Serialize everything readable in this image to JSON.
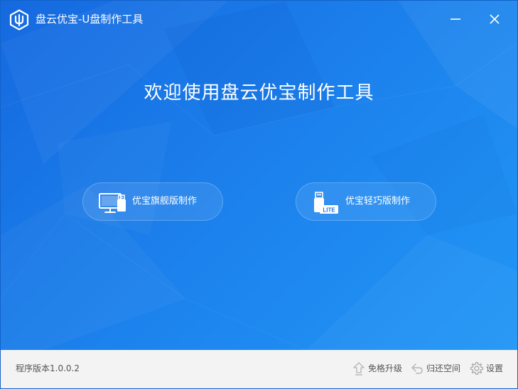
{
  "window": {
    "title": "盘云优宝-U盘制作工具",
    "minimize_icon": "minimize-icon",
    "close_icon": "close-icon"
  },
  "main": {
    "welcome_text": "欢迎使用盘云优宝制作工具",
    "buttons": [
      {
        "label": "优宝旗舰版制作",
        "icon": "computer-usb-icon"
      },
      {
        "label": "优宝轻巧版制作",
        "icon": "usb-lite-icon",
        "icon_badge": "LITE"
      }
    ]
  },
  "footer": {
    "version": "程序版本1.0.0.2",
    "links": [
      {
        "label": "免格升级",
        "icon": "upgrade-arrow-icon"
      },
      {
        "label": "归还空间",
        "icon": "return-arrow-icon"
      },
      {
        "label": "设置",
        "icon": "gear-icon"
      }
    ]
  },
  "colors": {
    "main_bg_start": "#1569df",
    "main_bg_end": "#2196f5",
    "footer_bg": "#f3f3f3",
    "footer_text": "#555555"
  }
}
